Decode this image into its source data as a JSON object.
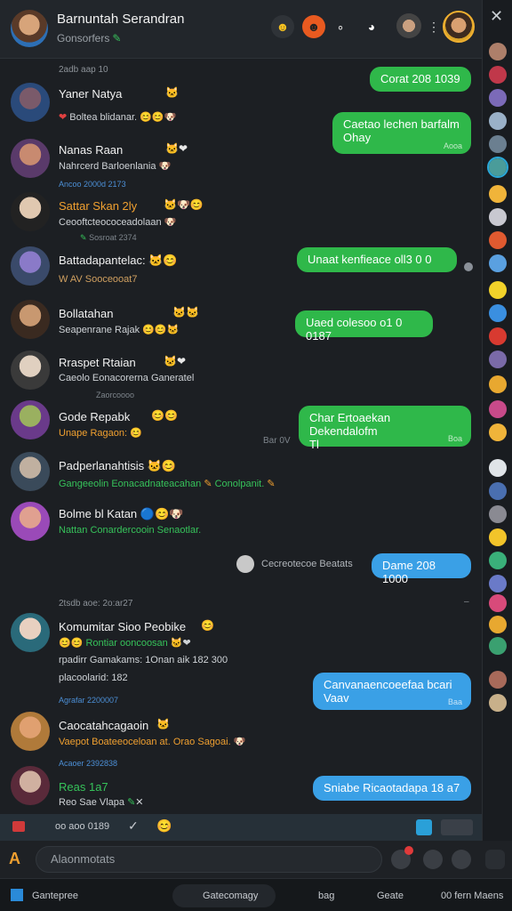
{
  "header": {
    "title": "Barnuntah Serandran",
    "subtitle": "Gonsorfers"
  },
  "toolbar_text": "oo aoo 0189",
  "rows": [
    {
      "name": "Yaner Natya",
      "line1": "Boltea blidanar."
    },
    {
      "name": "Nanas Raan",
      "line1": "Nahrcerd Barloenlania",
      "meta": "Ancoo 2000d 2173"
    },
    {
      "name": "Sattar Skan 2ly",
      "line1": "Ceooftcteococeadolaan",
      "meta": "Sosroat 2374"
    },
    {
      "name": "Battadapantelac:",
      "line1": "W AV   Sooceooat7"
    },
    {
      "name": "Bollatahan",
      "line1": "Seapenrane Rajak"
    },
    {
      "name": "Rraspet Rtaian",
      "line1": "Caeolo Eonacorerna Ganeratel",
      "meta": "Zaorcoooo"
    },
    {
      "name": "Gode Repabk",
      "line1": "Unape Ragaon:"
    },
    {
      "name": "Padperlanahtisis",
      "line1": "Gangeeolin Eonacadnateacahan",
      "line1b": "Conolpanit."
    },
    {
      "name": "Bolme bl Katan",
      "line1": "Nattan Conardercooin Senaotlar."
    },
    {
      "name": "Komumitar Sioo Peobike",
      "line1": "Rontiar ooncoosan",
      "line2": "rpadirr Gamakams: 1Onan aik 182 300",
      "line3": "placoolarid: 182",
      "meta": "Agrafar 2200007"
    },
    {
      "name": "Caocatahcagaoin",
      "line1": "Vaepot Boateeoceloan at. Orao Sagoai.",
      "meta": "Acaoer 2392838"
    },
    {
      "name": "Reas 1a7",
      "line1": "Reo Sae Vlapa"
    }
  ],
  "divider1": "2adb aap 10",
  "divider2": "2tsdb aoe: 2o:ar27",
  "messages_right": [
    {
      "text": "Corat 208 1039"
    },
    {
      "text": "Caetao lechen barfalm",
      "text2": "Ohay",
      "time": "Aooa"
    },
    {
      "text": "Unaat kenfieace oll3 0 0"
    },
    {
      "text": "Uaed colesoo o1 0 0187"
    },
    {
      "text": "Char Ertoaekan Dekendalofm",
      "text2": "Tl",
      "time": "Boa"
    },
    {
      "text": "Dame 208 1000"
    },
    {
      "text": "Canvanaencoeefaa bcari",
      "text2": "Vaav",
      "time": "Baa"
    },
    {
      "text": "Sniabe Ricaotadapa 18 a7"
    }
  ],
  "side_note": "Bar 0V",
  "center_note": "Cecreotecoe Beatats",
  "composer": {
    "placeholder": "Alaonmotats"
  },
  "taskbar": {
    "start": "Gantepree",
    "search": "Gatecomagy",
    "item2": "bag",
    "item3": "Geate",
    "clock": "00 fern Maens"
  }
}
